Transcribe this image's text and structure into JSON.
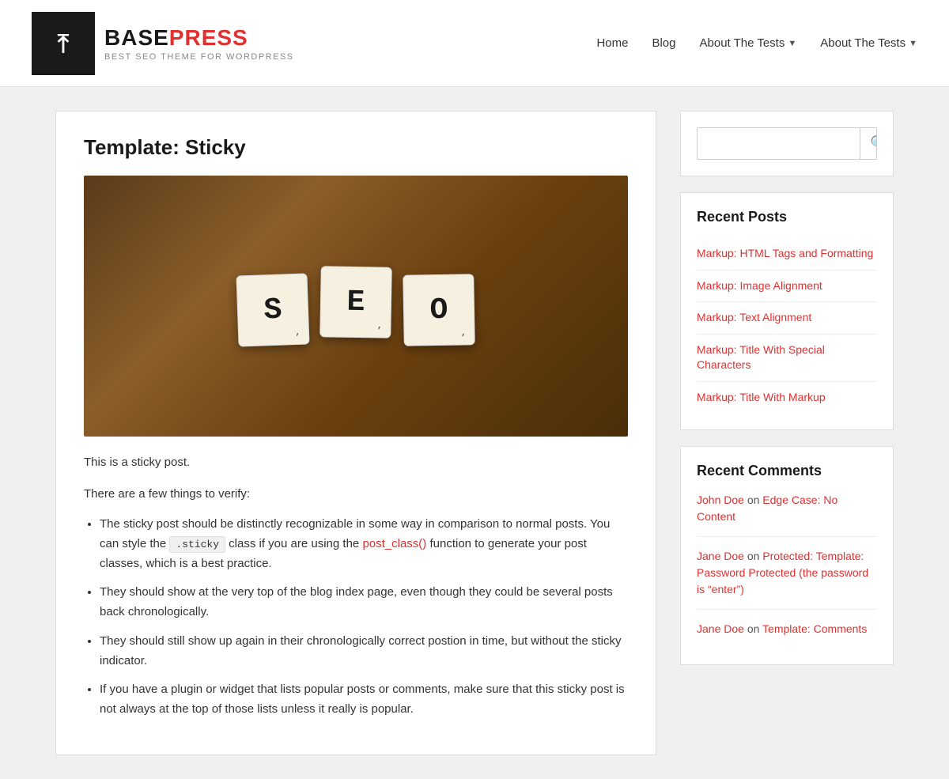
{
  "header": {
    "logo": {
      "brand_base": "BASE",
      "brand_press": "PRESS",
      "tagline": "BEST SEO THEME FOR WORDPRESS"
    },
    "nav": [
      {
        "label": "Home",
        "has_dropdown": false
      },
      {
        "label": "Blog",
        "has_dropdown": false
      },
      {
        "label": "About The Tests",
        "has_dropdown": true
      },
      {
        "label": "About The Tests",
        "has_dropdown": true
      }
    ]
  },
  "main": {
    "page_title": "Template: Sticky",
    "seo_tiles": [
      "S",
      "E",
      "O"
    ],
    "intro_line1": "This is a sticky post.",
    "intro_line2": "There are a few things to verify:",
    "bullet_points": [
      {
        "text_before": "The sticky post should be distinctly recognizable in some way in comparison to normal posts. You can style the ",
        "code": ".sticky",
        "text_middle": " class if you are using the ",
        "link_text": "post_class()",
        "link_url": "#",
        "text_after": " function to generate your post classes, which is a best practice."
      },
      {
        "text": "They should show at the very top of the blog index page, even though they could be several posts back chronologically."
      },
      {
        "text": "They should still show up again in their chronologically correct postion in time, but without the sticky indicator."
      },
      {
        "text": "If you have a plugin or widget that lists popular posts or comments, make sure that this sticky post is not always at the top of those lists unless it really is popular."
      }
    ]
  },
  "sidebar": {
    "search": {
      "placeholder": ""
    },
    "recent_posts": {
      "title": "Recent Posts",
      "items": [
        {
          "label": "Markup: HTML Tags and Formatting",
          "url": "#"
        },
        {
          "label": "Markup: Image Alignment",
          "url": "#"
        },
        {
          "label": "Markup: Text Alignment",
          "url": "#"
        },
        {
          "label": "Markup: Title With Special Characters",
          "url": "#"
        },
        {
          "label": "Markup: Title With Markup",
          "url": "#"
        }
      ]
    },
    "recent_comments": {
      "title": "Recent Comments",
      "items": [
        {
          "commenter": "John Doe",
          "commenter_url": "#",
          "on_text": "on",
          "post_link": "Edge Case: No Content",
          "post_url": "#"
        },
        {
          "commenter": "Jane Doe",
          "commenter_url": "#",
          "on_text": "on",
          "post_link": "Protected: Template: Password Protected (the password is “enter”)",
          "post_url": "#"
        },
        {
          "commenter": "Jane Doe",
          "commenter_url": "#",
          "on_text": "on",
          "post_link": "Template: Comments",
          "post_url": "#"
        }
      ]
    }
  }
}
